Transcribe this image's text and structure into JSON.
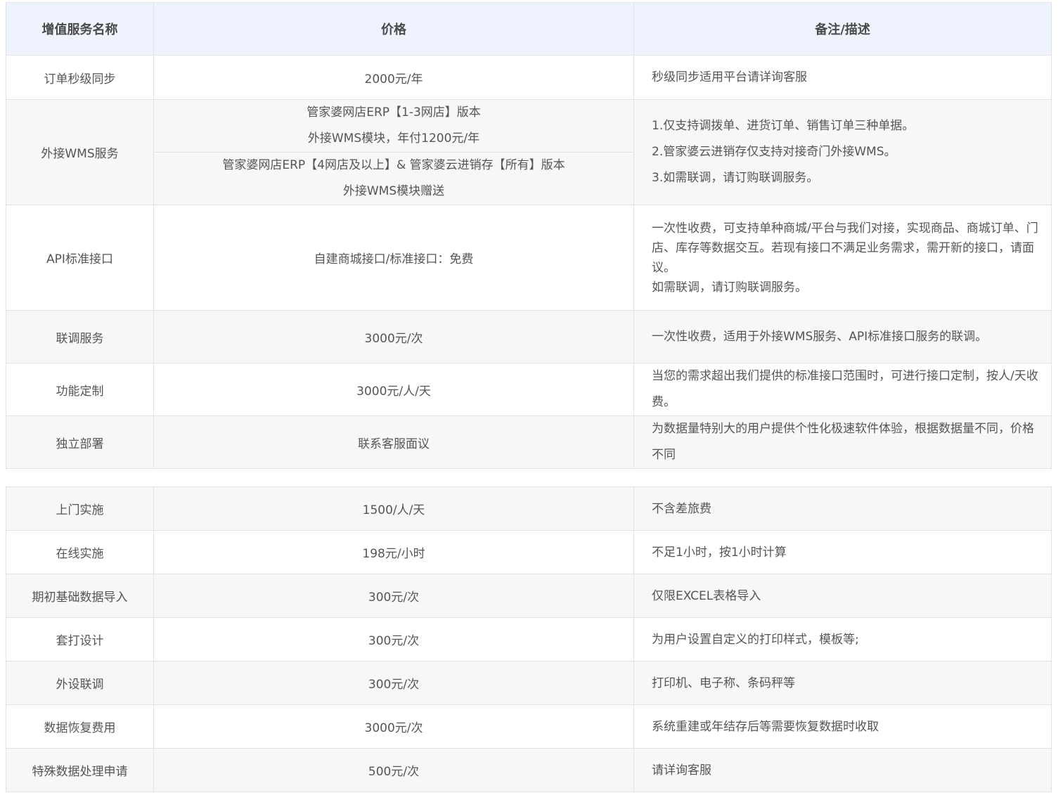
{
  "header": {
    "name": "增值服务名称",
    "price": "价格",
    "desc": "备注/描述"
  },
  "table1": {
    "r1": {
      "name": "订单秒级同步",
      "price": "2000元/年",
      "desc": "秒级同步适用平台请详询客服"
    },
    "r2": {
      "name": "外接WMS服务",
      "price_a1": "管家婆网店ERP【1-3网店】版本",
      "price_a2": "外接WMS模块，年付1200元/年",
      "price_b1": "管家婆网店ERP【4网店及以上】& 管家婆云进销存【所有】版本",
      "price_b2": "外接WMS模块赠送",
      "desc1": "1.仅支持调拨单、进货订单、销售订单三种单据。",
      "desc2": "2.管家婆云进销存仅支持对接奇门外接WMS。",
      "desc3": "3.如需联调，请订购联调服务。"
    },
    "r3": {
      "name": "API标准接口",
      "price": "自建商城接口/标准接口：免费",
      "desc1": "一次性收费，可支持单种商城/平台与我们对接，实现商品、商城订单、门店、库存等数据交互。若现有接口不满足业务需求，需开新的接口，请面议。",
      "desc2": "如需联调，请订购联调服务。"
    },
    "r4": {
      "name": "联调服务",
      "price": "3000元/次",
      "desc": "一次性收费，适用于外接WMS服务、API标准接口服务的联调。"
    },
    "r5": {
      "name": "功能定制",
      "price": "3000元/人/天",
      "desc": "当您的需求超出我们提供的标准接口范围时，可进行接口定制，按人/天收费。"
    },
    "r6": {
      "name": "独立部署",
      "price": "联系客服面议",
      "desc": "为数据量特别大的用户提供个性化极速软件体验，根据数据量不同，价格不同"
    }
  },
  "table2": [
    {
      "name": "上门实施",
      "price": "1500/人/天",
      "desc": "不含差旅费"
    },
    {
      "name": "在线实施",
      "price": "198元/小时",
      "desc": "不足1小时，按1小时计算"
    },
    {
      "name": "期初基础数据导入",
      "price": "300元/次",
      "desc": "仅限EXCEL表格导入"
    },
    {
      "name": "套打设计",
      "price": "300元/次",
      "desc": "为用户设置自定义的打印样式，模板等;"
    },
    {
      "name": "外设联调",
      "price": "300元/次",
      "desc": "打印机、电子称、条码秤等"
    },
    {
      "name": "数据恢复费用",
      "price": "3000元/次",
      "desc": "系统重建或年结存后等需要恢复数据时收取"
    },
    {
      "name": "特殊数据处理申请",
      "price": "500元/次",
      "desc": "请详询客服"
    }
  ]
}
